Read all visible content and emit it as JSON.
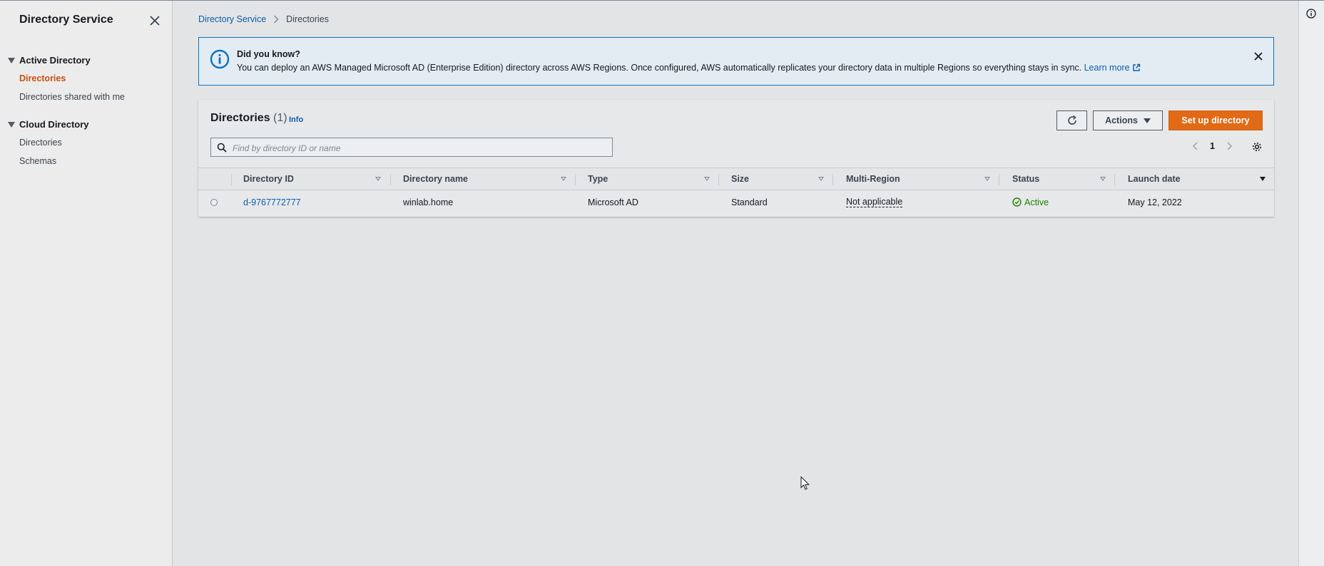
{
  "sidebar": {
    "title": "Directory Service",
    "sections": [
      {
        "label": "Active Directory",
        "items": [
          {
            "label": "Directories",
            "active": true
          },
          {
            "label": "Directories shared with me",
            "active": false
          }
        ]
      },
      {
        "label": "Cloud Directory",
        "items": [
          {
            "label": "Directories",
            "active": false
          },
          {
            "label": "Schemas",
            "active": false
          }
        ]
      }
    ]
  },
  "breadcrumb": {
    "parent": "Directory Service",
    "current": "Directories"
  },
  "banner": {
    "title": "Did you know?",
    "text": "You can deploy an AWS Managed Microsoft AD (Enterprise Edition) directory across AWS Regions. Once configured, AWS automatically replicates your directory data in multiple Regions so everything stays in sync. ",
    "link_label": "Learn more"
  },
  "panel": {
    "title": "Directories",
    "count": "(1)",
    "info_label": "Info",
    "actions_label": "Actions",
    "setup_label": "Set up directory",
    "search_placeholder": "Find by directory ID or name",
    "page": "1"
  },
  "table": {
    "columns": [
      "Directory ID",
      "Directory name",
      "Type",
      "Size",
      "Multi-Region",
      "Status",
      "Launch date"
    ],
    "rows": [
      {
        "directory_id": "d-9767772777",
        "directory_name": "winlab.home",
        "type": "Microsoft AD",
        "size": "Standard",
        "multi_region": "Not applicable",
        "status": "Active",
        "launch_date": "May 12, 2022"
      }
    ]
  },
  "colors": {
    "accent": "#e06a16",
    "link": "#0c5ea8",
    "active_nav": "#ca4f0f",
    "status_ok": "#1d8102",
    "banner_border": "#0f73bb"
  }
}
